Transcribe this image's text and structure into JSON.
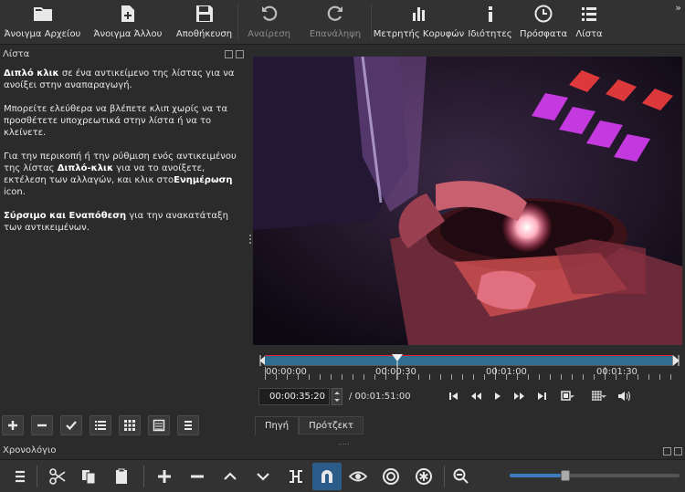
{
  "toolbar": {
    "open_file": "Άνοιγμα Αρχείου",
    "open_other": "Άνοιγμα Άλλου",
    "save": "Αποθήκευση",
    "undo": "Αναίρεση",
    "redo": "Επανάληψη",
    "peak_meter": "Μετρητής Κορυφών",
    "properties": "Ιδιότητες",
    "recent": "Πρόσφατα",
    "playlist": "Λίστα",
    "more": "»"
  },
  "playlist_panel": {
    "title": "Λίστα",
    "help": {
      "p1_bold": "Διπλό κλικ",
      "p1_rest": " σε ένα αντικείμενο της λίστας για να ανοίξει στην αναπαραγωγή.",
      "p2": " Μπορείτε ελεύθερα να βλέπετε κλιπ χωρίς να τα προσθέτετε υποχρεωτικά στην λίστα ή να το κλείνετε.",
      "p3_a": "Για την περικοπή ή την ρύθμιση ενός αντικειμένου της λίστας ",
      "p3_bold1": "Διπλό-κλικ",
      "p3_b": " για να το ανοίξετε, εκτέλεση των αλλαγών, και κλικ στο",
      "p3_bold2": "Ενημέρωση",
      "p3_c": " icon.",
      "p4_bold": "Σύρσιμο και Εναπόθεση",
      "p4_rest": " για την ανακατάταξη των αντικειμένων."
    }
  },
  "player": {
    "scrub_labels": [
      "00:00:00",
      "00:00:30",
      "00:01:00",
      "00:01:30"
    ],
    "position": "00:00:35:20",
    "duration": "/ 00:01:51:00",
    "tab_source": "Πηγή",
    "tab_project": "Πρότζεκτ"
  },
  "timeline": {
    "title": "Χρονολόγιο",
    "zoom_level": 0.3
  }
}
